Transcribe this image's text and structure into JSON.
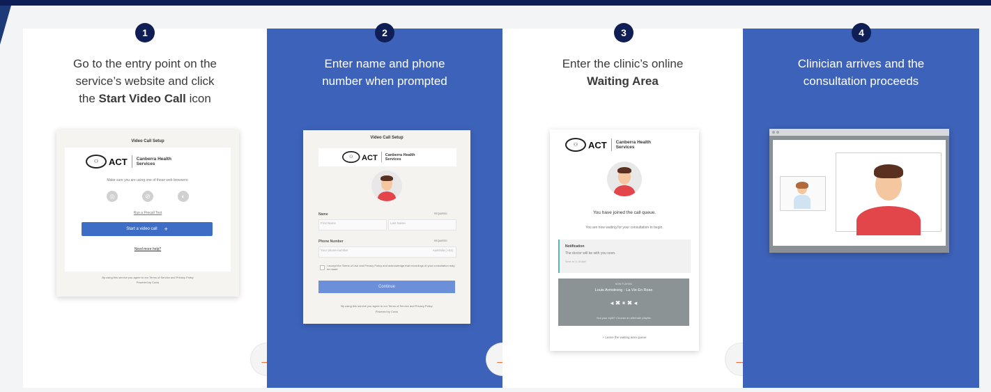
{
  "steps": [
    {
      "number": "1",
      "title_line1": "Go to the entry point on the",
      "title_line2": "service’s website and click",
      "title_pre": "the ",
      "title_bold": "Start Video Call",
      "title_post": " icon"
    },
    {
      "number": "2",
      "title_line1": "Enter name and phone",
      "title_line2": "number when prompted"
    },
    {
      "number": "3",
      "title_line1": "Enter the clinic’s online",
      "title_bold": "Waiting Area"
    },
    {
      "number": "4",
      "title_line1": "Clinician arrives and the",
      "title_line2": "consultation proceeds"
    }
  ],
  "arrow_symbol": "→",
  "card1": {
    "header": "Video Call Setup",
    "logo_text": "ACT",
    "org_name": "Canberra Health Services",
    "browsers_text": "Make sure you are using one of these web browsers:",
    "precall_link": "Run a Precall Test",
    "start_button": "Start a video call",
    "start_icon": "+",
    "help_link": "Need more help?",
    "footer_line1": "By using this service you agree to our Terms of Service and Privacy Policy",
    "footer_line2": "Powered by Coviu"
  },
  "card2": {
    "header": "Video Call Setup",
    "logo_text": "ACT",
    "org_name": "Canberra Health Services",
    "name_label": "Name",
    "required": "REQUIRED",
    "first_name_placeholder": "First Name",
    "last_name_placeholder": "Last Name",
    "phone_label": "Phone Number",
    "phone_placeholder": "Your phone number",
    "phone_region": "Australia (+61)",
    "consent_text": "I accept the Terms of Use and Privacy Policy and acknowledge that recordings of your consultation may be made",
    "continue_button": "Continue",
    "footer_line1": "By using this service you agree to our Terms of Service and Privacy Policy",
    "footer_line2": "Powered by Coviu"
  },
  "card3": {
    "logo_text": "ACT",
    "org_name": "Canberra Health Services",
    "joined_text": "You have joined the call queue.",
    "waiting_text": "You are now waiting for your consultation to begin.",
    "notif_title": "Notification",
    "notif_body": "The doctor will be with you soon.",
    "notif_time": "Sent at 11:30AM",
    "now_playing": "NOW PLAYING",
    "track": "Louis Armstrong - La Vie En Rose",
    "controls": "◂ ✖ ⏸ ✖ ◂",
    "player_hint": "Not your style? Choose an alternate playlist",
    "leave_text": "Leave the waiting area queue"
  },
  "colors": {
    "navy": "#0f1e55",
    "panel_blue": "#3d62b9",
    "arrow_orange": "#e5723d"
  }
}
